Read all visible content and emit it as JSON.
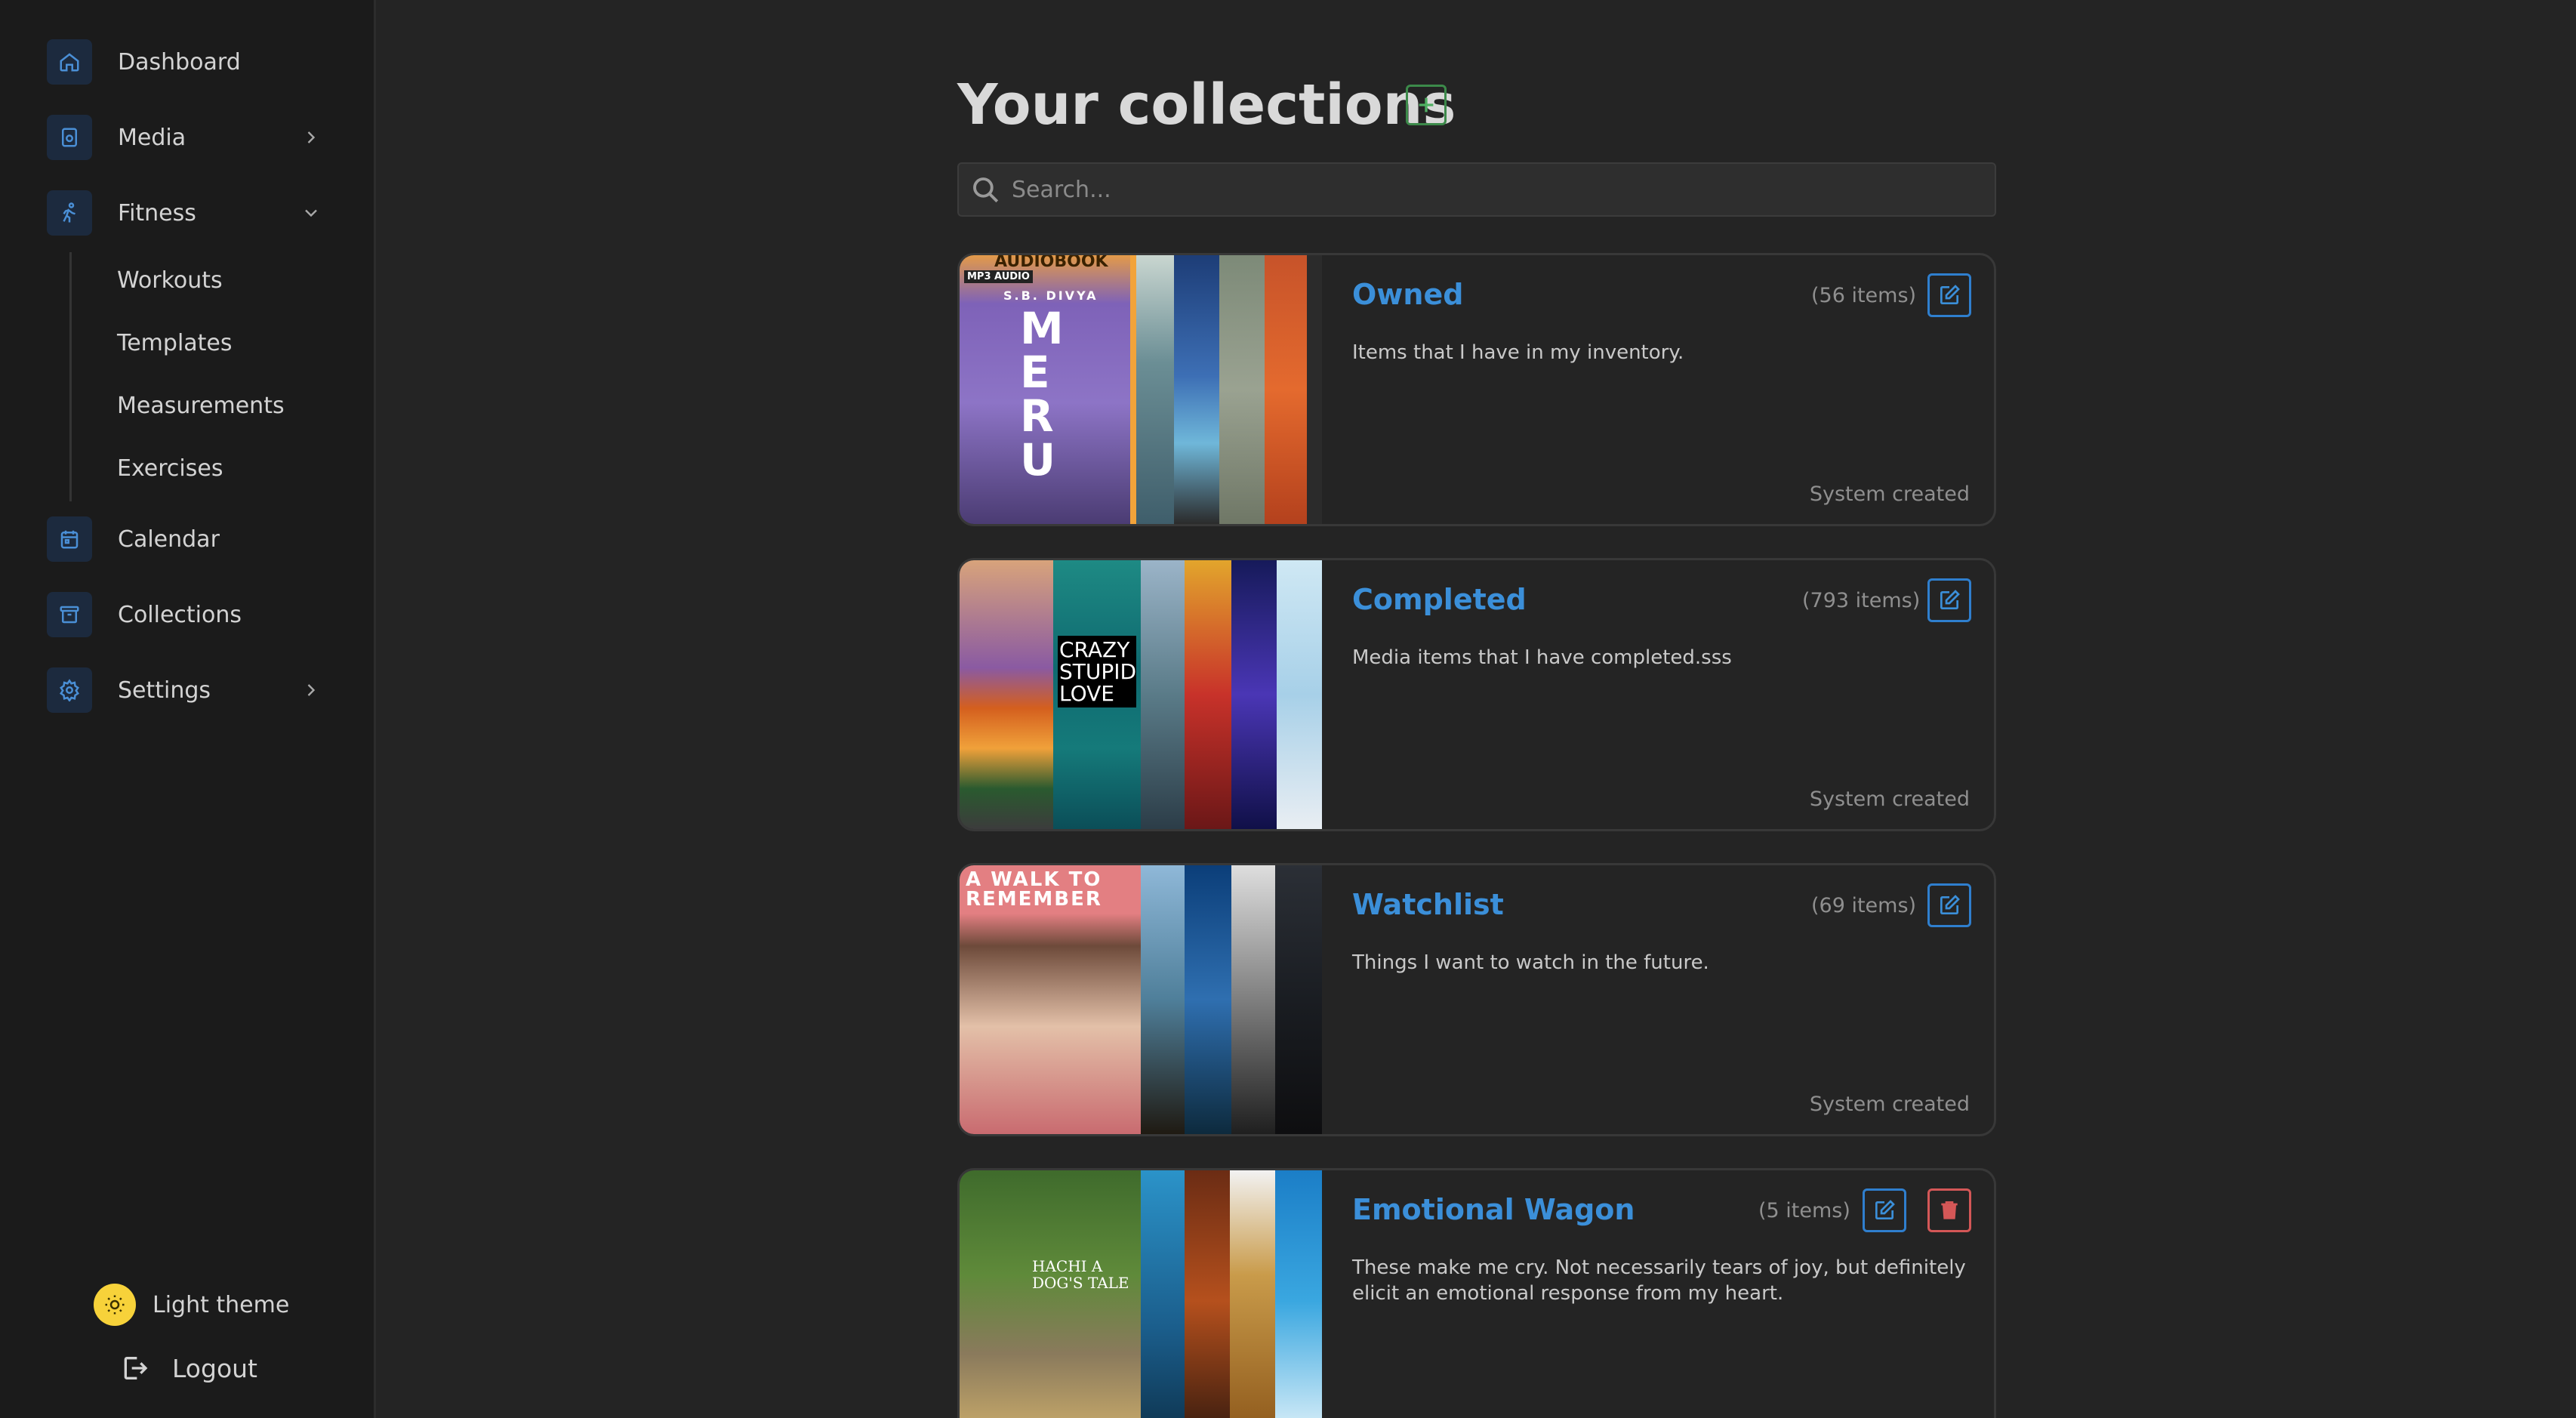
{
  "sidebar": {
    "items": [
      {
        "label": "Dashboard",
        "icon": "home-icon"
      },
      {
        "label": "Media",
        "icon": "media-icon"
      },
      {
        "label": "Fitness",
        "icon": "run-icon"
      },
      {
        "label": "Calendar",
        "icon": "calendar-icon"
      },
      {
        "label": "Collections",
        "icon": "archive-icon"
      },
      {
        "label": "Settings",
        "icon": "gear-icon"
      }
    ],
    "fitness_sub": [
      "Workouts",
      "Templates",
      "Measurements",
      "Exercises"
    ],
    "theme_label": "Light theme",
    "logout_label": "Logout"
  },
  "main": {
    "title": "Your collections",
    "search_placeholder": "Search...",
    "collections": [
      {
        "name": "Owned",
        "count": "(56 items)",
        "description": "Items that I have in my inventory.",
        "footer": "System created",
        "poster_texts": {
          "audiobook": "AUDIOBOOK",
          "mp3": "MP3 AUDIO",
          "author": "S.B. DIVYA",
          "title": "MERU"
        }
      },
      {
        "name": "Completed",
        "count": "(793 items)",
        "description": "Media items that I have completed.sss",
        "footer": "System created",
        "poster_texts": {
          "title": "CRAZY STUPID LOVE"
        }
      },
      {
        "name": "Watchlist",
        "count": "(69 items)",
        "description": "Things I want to watch in the future.",
        "footer": "System created",
        "poster_texts": {
          "title": "A WALK TO REMEMBER"
        }
      },
      {
        "name": "Emotional Wagon",
        "count": "(5 items)",
        "description": "These make me cry. Not necessarily tears of joy, but definitely elicit an emotional response from my heart.",
        "poster_texts": {
          "title": "HACHI A DOG'S TALE"
        }
      }
    ]
  },
  "colors": {
    "accent": "#3b8fd9",
    "add_button": "#3c8a4a",
    "delete": "#d45757",
    "theme_dot": "#f7d23a"
  }
}
